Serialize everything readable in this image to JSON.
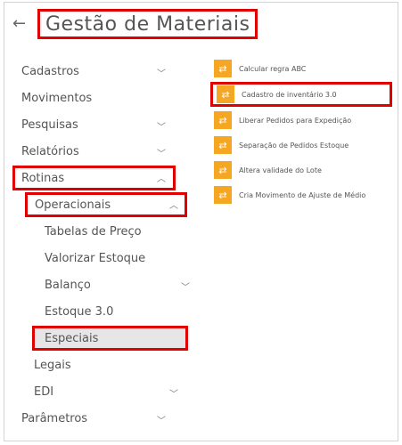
{
  "header": {
    "back_glyph": "←",
    "title": "Gestão de Materiais"
  },
  "menu": {
    "cadastros": "Cadastros",
    "movimentos": "Movimentos",
    "pesquisas": "Pesquisas",
    "relatorios": "Relatórios",
    "rotinas": "Rotinas",
    "operacionais": "Operacionais",
    "tabelas_preco": "Tabelas de Preço",
    "valorizar_estoque": "Valorizar Estoque",
    "balanco": "Balanço",
    "estoque30": "Estoque 3.0",
    "especiais": "Especiais",
    "legais": "Legais",
    "edi": "EDI",
    "parametros": "Parâmetros"
  },
  "right_items": [
    {
      "label": "Calcular regra ABC",
      "icon": "swap-icon"
    },
    {
      "label": "Cadastro de inventário 3.0",
      "icon": "swap-icon"
    },
    {
      "label": "Liberar Pedidos para Expedição",
      "icon": "swap-icon"
    },
    {
      "label": "Separação de Pedidos Estoque",
      "icon": "swap-icon"
    },
    {
      "label": "Altera validade do Lote",
      "icon": "swap-icon"
    },
    {
      "label": "Cria Movimento de Ajuste de Médio",
      "icon": "swap-icon"
    }
  ],
  "colors": {
    "highlight": "#e00000",
    "icon_bg": "#f5a623",
    "selected_bg": "#e6e6e6"
  }
}
